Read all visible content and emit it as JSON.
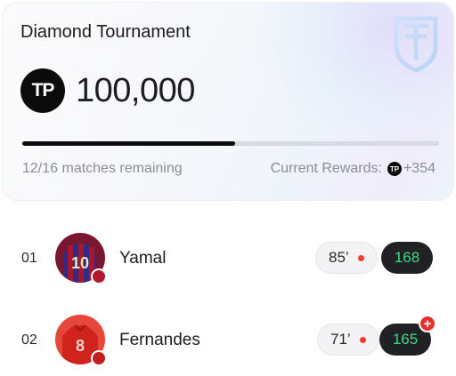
{
  "tournament": {
    "title": "Diamond Tournament",
    "tp_badge": "TP",
    "amount": "100,000",
    "progress": 0.51,
    "matches_remaining": "12/16 matches remaining",
    "rewards_label": "Current Rewards:",
    "rewards_tp": "TP",
    "rewards_value": "+354",
    "crest_icon": "shield-crest-icon"
  },
  "players": [
    {
      "rank": "01",
      "name": "Yamal",
      "minute": "85’",
      "score": "168",
      "jersey_number": "10",
      "jersey_color": "#3d2b8f",
      "jersey_stripe": "#a8172e",
      "club_dot": "#b0192c",
      "boosted": false
    },
    {
      "rank": "02",
      "name": "Fernandes",
      "minute": "71’",
      "score": "165",
      "jersey_number": "8",
      "jersey_color": "#d62a22",
      "jersey_stripe": "#d62a22",
      "club_dot": "#c21e1e",
      "boosted": true
    }
  ],
  "colors": {
    "accent_green": "#3ddc84",
    "live_red": "#ff3b30",
    "dark": "#0b0b0b"
  }
}
